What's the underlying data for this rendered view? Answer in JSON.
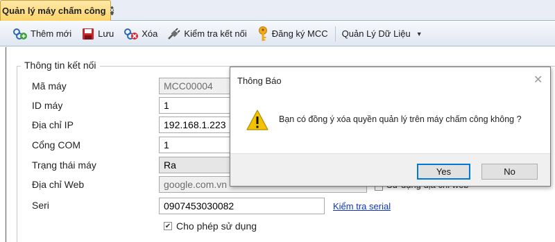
{
  "tab": {
    "label": "Quản lý máy chấm công",
    "close": "×"
  },
  "toolbar": {
    "add": "Thêm mới",
    "save": "Lưu",
    "delete": "Xóa",
    "check_connection": "Kiểm tra kết nối",
    "register": "Đăng ký MCC",
    "data_manage": "Quản Lý Dữ Liệu",
    "dropdown_arrow": "▼"
  },
  "form": {
    "legend": "Thông tin kết nối",
    "fields": {
      "machine_code_label": "Mã máy",
      "machine_code_value": "MCC00004",
      "machine_id_label": "ID máy",
      "machine_id_value": "1",
      "ip_label": "Địa chỉ IP",
      "ip_value": "192.168.1.223",
      "com_label": "Cổng COM",
      "com_value": "1",
      "status_label": "Trạng thái máy",
      "status_value": "Ra",
      "web_label": "Địa chỉ Web",
      "web_value": "google.com.vn",
      "use_web_label": "Sử dụng địa chỉ web",
      "serial_label": "Seri",
      "serial_value": "0907453030082",
      "check_serial_link": "Kiểm tra serial",
      "allow_use_label": "Cho phép sử dụng"
    }
  },
  "dialog": {
    "title": "Thông Báo",
    "close": "✕",
    "message": "Bạn có đồng ý xóa quyền quản lý trên máy chấm công không ?",
    "yes": "Yes",
    "no": "No"
  },
  "icons": {
    "tab_close": "close-icon",
    "add": "add-icon",
    "save": "save-icon",
    "delete": "delete-icon",
    "check": "plug-icon",
    "register": "key-icon",
    "warning": "warning-icon"
  },
  "colors": {
    "tab_active": "#fcd46a",
    "link": "#0b34c4",
    "default_button_border": "#0078d7",
    "warning": "#f4c300"
  }
}
